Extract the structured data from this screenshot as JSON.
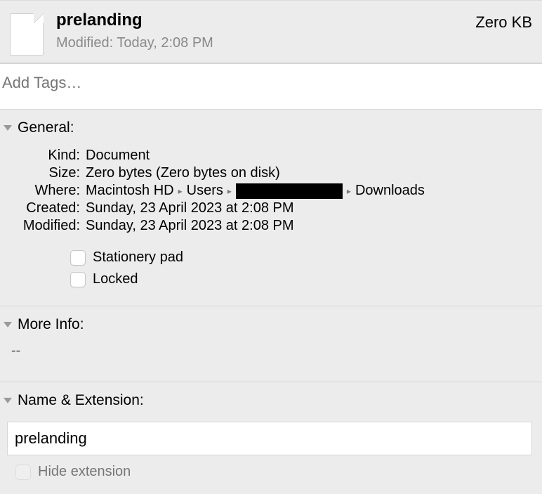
{
  "header": {
    "filename": "prelanding",
    "modified_prefix": "Modified:",
    "modified_value": "Today, 2:08 PM",
    "size": "Zero KB"
  },
  "tags": {
    "placeholder": "Add Tags…"
  },
  "sections": {
    "general": {
      "title": "General:",
      "kind_label": "Kind:",
      "kind_value": "Document",
      "size_label": "Size:",
      "size_value": "Zero bytes (Zero bytes on disk)",
      "where_label": "Where:",
      "where_parts": [
        "Macintosh HD",
        "Users",
        "",
        "Downloads"
      ],
      "created_label": "Created:",
      "created_value": "Sunday, 23 April 2023 at 2:08 PM",
      "modified_label": "Modified:",
      "modified_value": "Sunday, 23 April 2023 at 2:08 PM",
      "stationery_label": "Stationery pad",
      "locked_label": "Locked"
    },
    "more_info": {
      "title": "More Info:",
      "content": "--"
    },
    "name_ext": {
      "title": "Name & Extension:",
      "value": "prelanding",
      "hide_ext_label": "Hide extension"
    }
  }
}
